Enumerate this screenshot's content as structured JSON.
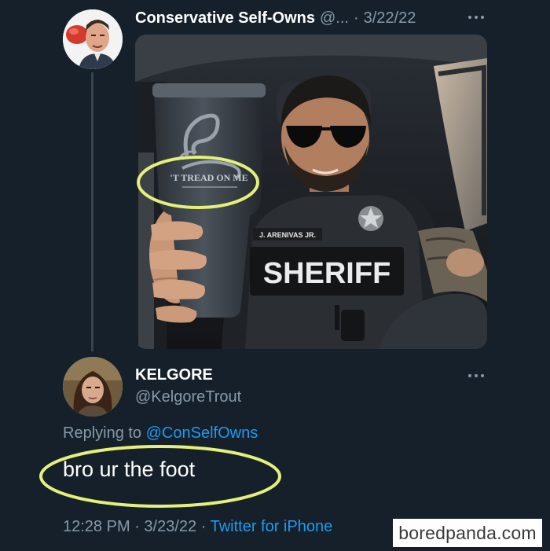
{
  "original_tweet": {
    "display_name": "Conservative Self-Owns",
    "handle": "@...",
    "separator": "·",
    "date": "3/22/22",
    "image": {
      "cup_text": "'T TREAD ON ME",
      "badge_name": "J. ARENIVAS JR.",
      "vest_text": "SHERIFF"
    }
  },
  "reply_tweet": {
    "display_name": "KELGORE",
    "handle": "@KelgoreTrout",
    "replying_prefix": "Replying to",
    "replying_mention": "@ConSelfOwns",
    "text": "bro ur the foot",
    "time": "12:28 PM",
    "separator": "·",
    "date": "3/23/22",
    "source": "Twitter for iPhone"
  },
  "watermark": "boredpanda.com",
  "colors": {
    "background": "#15202b",
    "secondary_text": "#8899a6",
    "link": "#1d9bf0",
    "highlight": "#e4f07a"
  }
}
